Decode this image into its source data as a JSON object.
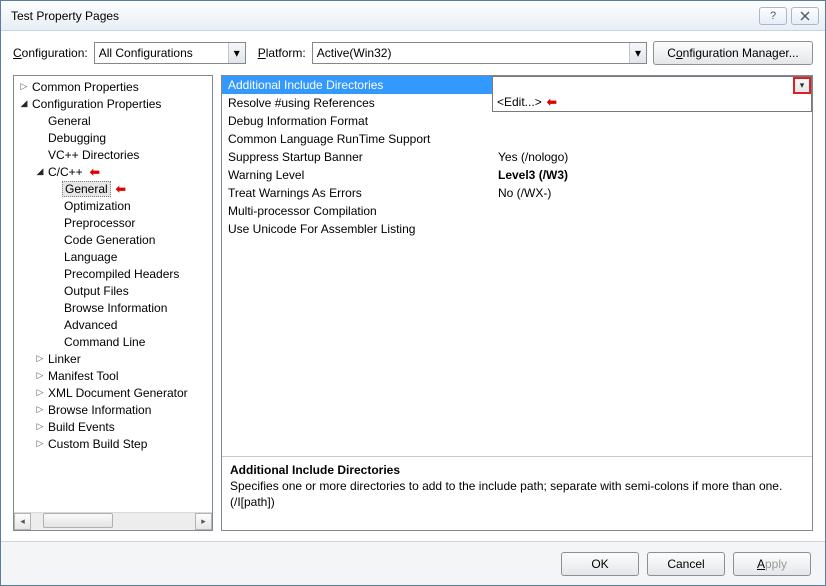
{
  "window": {
    "title": "Test Property Pages"
  },
  "toprow": {
    "config_label": "Configuration:",
    "config_value": "All Configurations",
    "platform_label": "Platform:",
    "platform_value": "Active(Win32)",
    "cfgmgr": "Configuration Manager..."
  },
  "tree": {
    "common": "Common Properties",
    "cfgprops": "Configuration Properties",
    "general_top": "General",
    "debugging": "Debugging",
    "vcdirs": "VC++ Directories",
    "ccpp": "C/C++",
    "cc_general": "General",
    "cc_opt": "Optimization",
    "cc_prep": "Preprocessor",
    "cc_codegen": "Code Generation",
    "cc_lang": "Language",
    "cc_pch": "Precompiled Headers",
    "cc_out": "Output Files",
    "cc_browse": "Browse Information",
    "cc_adv": "Advanced",
    "cc_cmd": "Command Line",
    "linker": "Linker",
    "manifest": "Manifest Tool",
    "xmldoc": "XML Document Generator",
    "browse": "Browse Information",
    "buildev": "Build Events",
    "custom": "Custom Build Step"
  },
  "grid": [
    {
      "label": "Additional Include Directories",
      "value": ""
    },
    {
      "label": "Resolve #using References",
      "value": "<Edit...>"
    },
    {
      "label": "Debug Information Format",
      "value": ""
    },
    {
      "label": "Common Language RunTime Support",
      "value": ""
    },
    {
      "label": "Suppress Startup Banner",
      "value": "Yes (/nologo)"
    },
    {
      "label": "Warning Level",
      "value": "Level3 (/W3)",
      "bold": true
    },
    {
      "label": "Treat Warnings As Errors",
      "value": "No (/WX-)"
    },
    {
      "label": "Multi-processor Compilation",
      "value": ""
    },
    {
      "label": "Use Unicode For Assembler Listing",
      "value": ""
    }
  ],
  "desc": {
    "title": "Additional Include Directories",
    "text": "Specifies one or more directories to add to the include path; separate with semi-colons if more than one.     (/I[path])"
  },
  "footer": {
    "ok": "OK",
    "cancel": "Cancel",
    "apply": "Apply"
  }
}
